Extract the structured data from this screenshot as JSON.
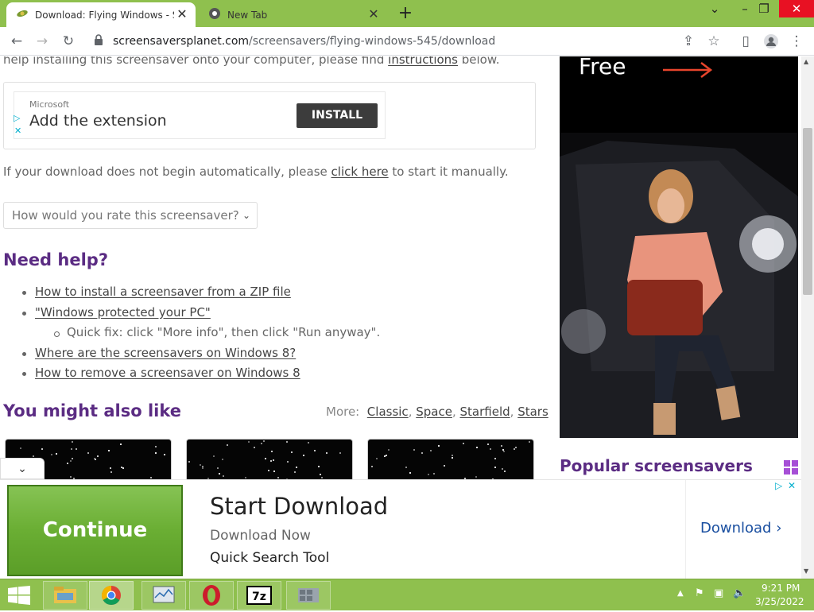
{
  "browser": {
    "tabs": [
      {
        "title": "Download: Flying Windows - Scr",
        "active": true
      },
      {
        "title": "New Tab",
        "active": false
      }
    ],
    "new_tab_label": "+",
    "url_host": "screensaversplanet.com",
    "url_path": "/screensavers/flying-windows-545/download"
  },
  "page": {
    "help_text_prefix": "help installing this screensaver onto your computer, please find ",
    "help_link": "instructions",
    "help_text_suffix": " below.",
    "ad": {
      "brand": "Microsoft",
      "headline": "Add the extension",
      "button": "INSTALL"
    },
    "download_prefix": "If your download does not begin automatically, please ",
    "download_link": "click here",
    "download_suffix": " to start it manually.",
    "rate_placeholder": "How would you rate this screensaver?",
    "need_help_title": "Need help?",
    "help_items": [
      "How to install a screensaver from a ZIP file",
      "\"Windows protected your PC\"",
      "Where are the screensavers on Windows 8?",
      "How to remove a screensaver on Windows 8"
    ],
    "quick_fix": "Quick fix: click \"More info\", then click \"Run anyway\".",
    "also_like_title": "You might also like",
    "more_label": "More:",
    "more_links": [
      "Classic",
      "Space",
      "Starfield",
      "Stars"
    ],
    "side_ad_text": "Free",
    "popular_title": "Popular screensavers"
  },
  "bottom_ad": {
    "continue": "Continue",
    "title": "Start Download",
    "subtitle": "Download Now",
    "tool": "Quick Search Tool",
    "download": "Download"
  },
  "taskbar": {
    "time": "9:21 PM",
    "date": "3/25/2022"
  }
}
